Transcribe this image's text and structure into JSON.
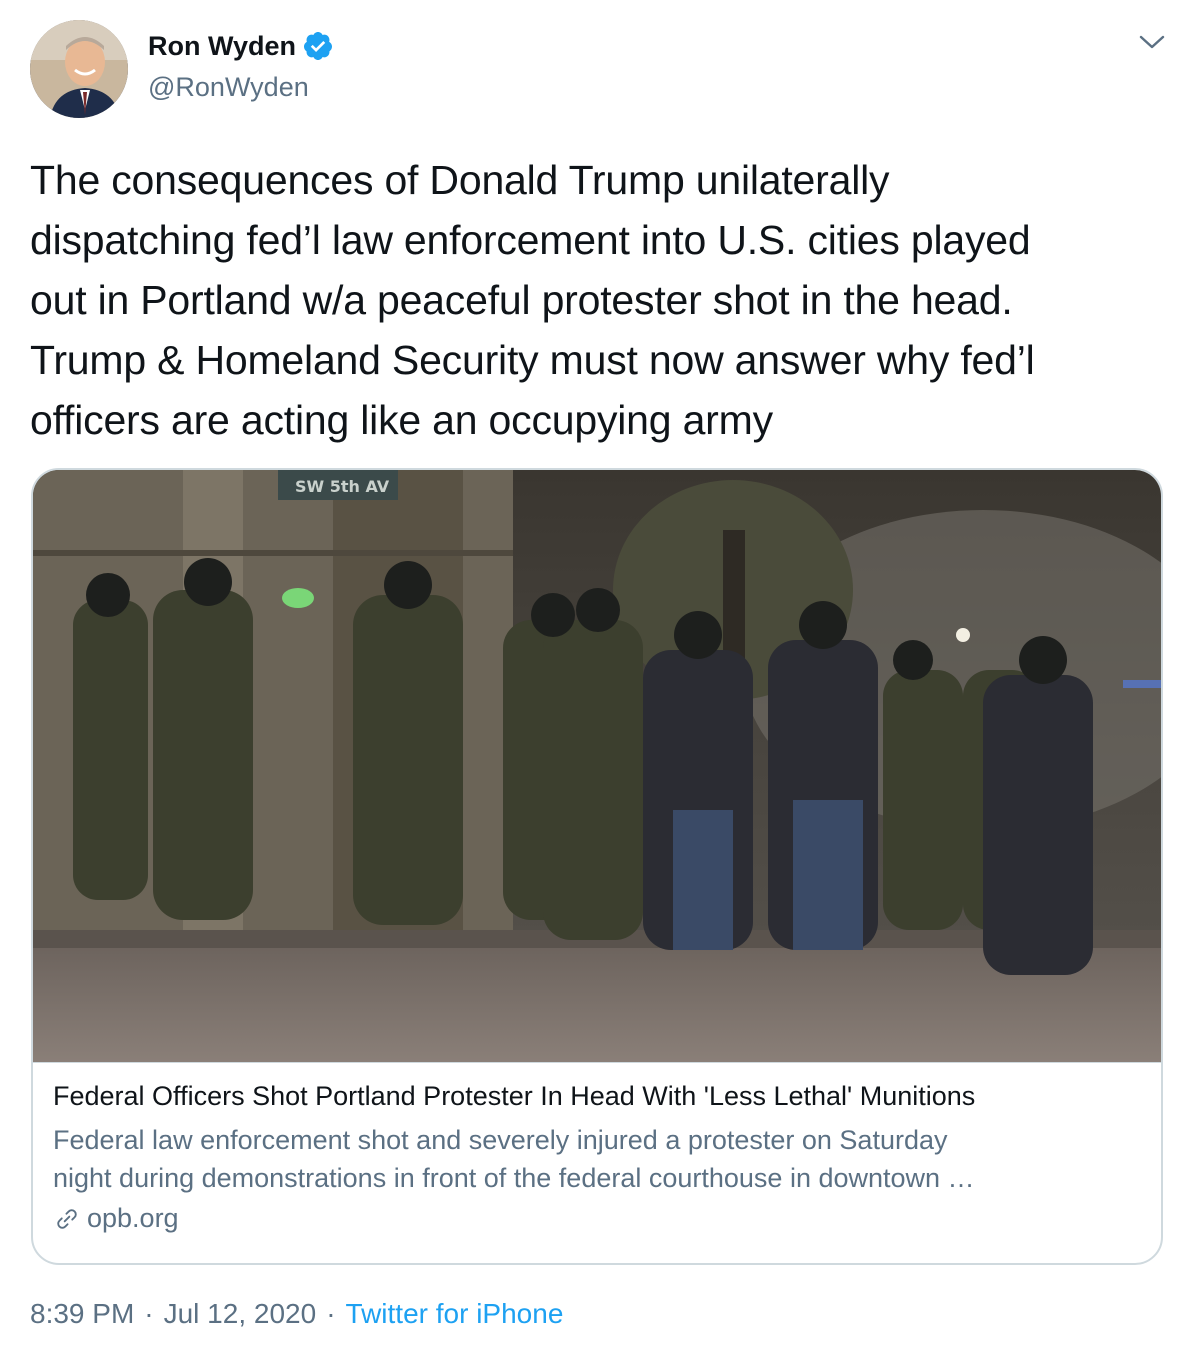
{
  "author": {
    "name": "Ron Wyden",
    "handle": "@RonWyden",
    "verified": true,
    "avatar_icon": "avatar-photo"
  },
  "tweet": {
    "text": "The consequences of Donald Trump unilaterally\ndispatching fed’l law enforcement into U.S. cities played\nout in Portland w/a peaceful protester shot in the head.\nTrump & Homeland Security must now answer why fed’l\nofficers are acting like an occupying army"
  },
  "card": {
    "image_sign_text": "SW 5th AV",
    "title": "Federal Officers Shot Portland Protester In Head With 'Less Lethal' Munitions",
    "description": "Federal law enforcement shot and severely injured a protester on Saturday\nnight during demonstrations in front of the federal courthouse in downtown …",
    "domain": "opb.org"
  },
  "meta": {
    "time": "8:39 PM",
    "sep1": "·",
    "date": "Jul 12, 2020",
    "sep2": "·",
    "source": "Twitter for iPhone"
  },
  "colors": {
    "accent": "#1da1f2",
    "secondary_text": "#5b7083",
    "border": "#cfd9de"
  }
}
